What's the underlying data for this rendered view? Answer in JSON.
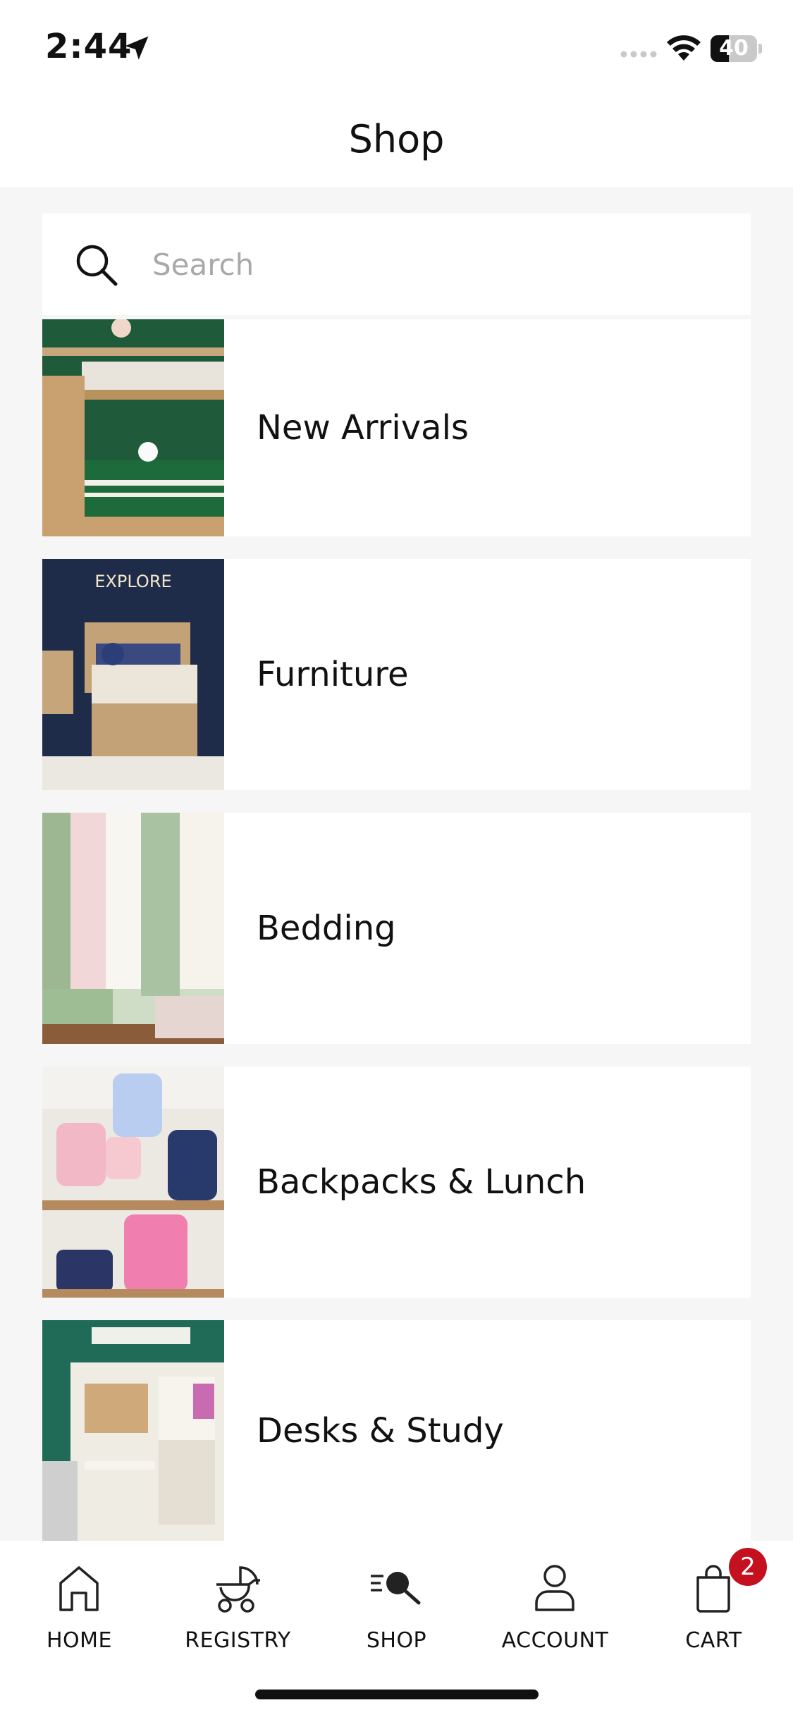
{
  "status_bar": {
    "time": "2:44",
    "battery_level": "40",
    "icons": [
      "location-arrow-icon",
      "cellular-signal-icon",
      "wifi-icon",
      "battery-icon"
    ]
  },
  "header": {
    "title": "Shop"
  },
  "search": {
    "placeholder": "Search",
    "value": ""
  },
  "categories": [
    {
      "label": "New Arrivals",
      "image": "bunk-bed-room-photo"
    },
    {
      "label": "Furniture",
      "image": "twin-bed-explore-sign-photo"
    },
    {
      "label": "Bedding",
      "image": "quilts-and-sheets-photo"
    },
    {
      "label": "Backpacks & Lunch",
      "image": "backpacks-and-lunch-boxes-photo"
    },
    {
      "label": "Desks & Study",
      "image": "desk-and-hutch-photo"
    }
  ],
  "tab_bar": {
    "items": [
      {
        "label": "HOME",
        "icon": "home-icon"
      },
      {
        "label": "REGISTRY",
        "icon": "stroller-icon"
      },
      {
        "label": "SHOP",
        "icon": "shop-search-icon"
      },
      {
        "label": "ACCOUNT",
        "icon": "person-icon"
      },
      {
        "label": "CART",
        "icon": "shopping-bag-icon"
      }
    ],
    "cart_count": "2",
    "active": "SHOP"
  },
  "colors": {
    "badge": "#c4101f",
    "background": "#f6f6f6",
    "card": "#ffffff"
  }
}
